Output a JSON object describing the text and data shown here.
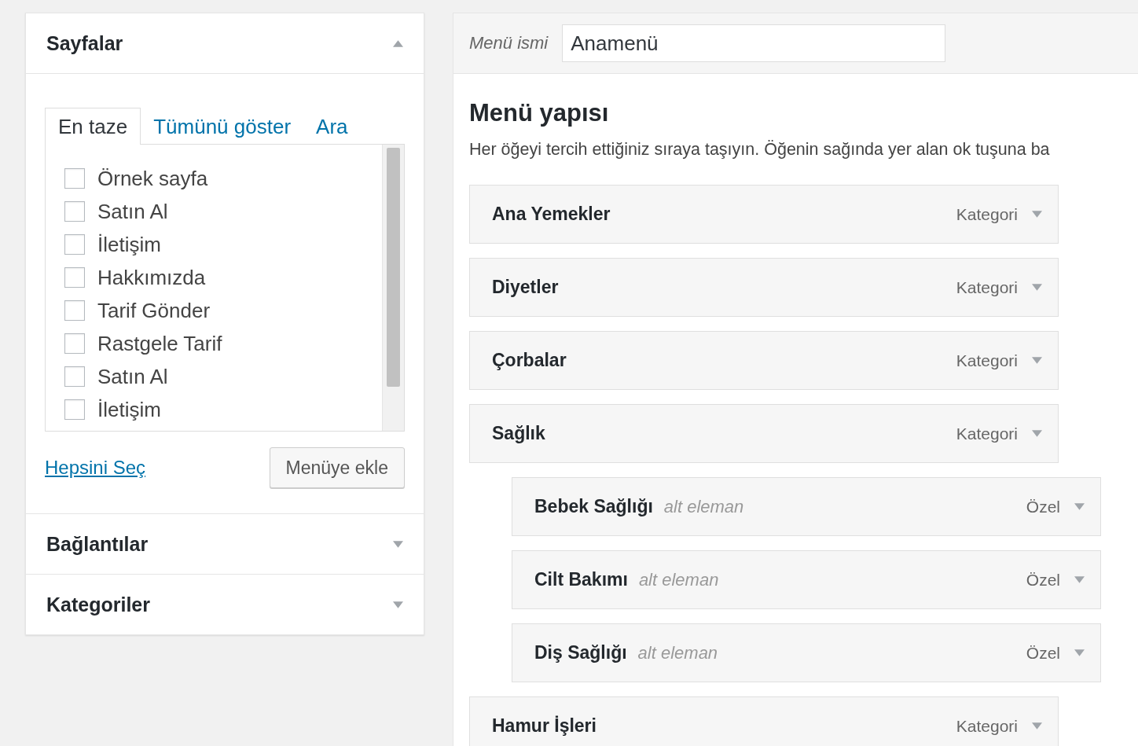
{
  "left_panel": {
    "sections": [
      {
        "title": "Sayfalar",
        "expanded": true,
        "tabs": [
          {
            "label": "En taze",
            "selected": true
          },
          {
            "label": "Tümünü göster",
            "selected": false
          },
          {
            "label": "Ara",
            "selected": false
          }
        ],
        "items": [
          {
            "label": "Örnek sayfa",
            "checked": false
          },
          {
            "label": "Satın Al",
            "checked": false
          },
          {
            "label": "İletişim",
            "checked": false
          },
          {
            "label": "Hakkımızda",
            "checked": false
          },
          {
            "label": "Tarif Gönder",
            "checked": false
          },
          {
            "label": "Rastgele Tarif",
            "checked": false
          },
          {
            "label": "Satın Al",
            "checked": false
          },
          {
            "label": "İletişim",
            "checked": false
          }
        ],
        "select_all": "Hepsini Seç",
        "add_button": "Menüye ekle"
      },
      {
        "title": "Bağlantılar",
        "expanded": false
      },
      {
        "title": "Kategoriler",
        "expanded": false
      }
    ]
  },
  "menu": {
    "name_label": "Menü ismi",
    "name_value": "Anamenü",
    "heading": "Menü yapısı",
    "description": "Her öğeyi tercih ettiğiniz sıraya taşıyın. Öğenin sağında yer alan ok tuşuna ba",
    "items": [
      {
        "title": "Ana Yemekler",
        "type": "Kategori"
      },
      {
        "title": "Diyetler",
        "type": "Kategori"
      },
      {
        "title": "Çorbalar",
        "type": "Kategori"
      },
      {
        "title": "Sağlık",
        "type": "Kategori",
        "children": [
          {
            "title": "Bebek Sağlığı",
            "sublabel": "alt eleman",
            "type": "Özel"
          },
          {
            "title": "Cilt Bakımı",
            "sublabel": "alt eleman",
            "type": "Özel"
          },
          {
            "title": "Diş Sağlığı",
            "sublabel": "alt eleman",
            "type": "Özel"
          }
        ]
      },
      {
        "title": "Hamur İşleri",
        "type": "Kategori"
      }
    ]
  }
}
